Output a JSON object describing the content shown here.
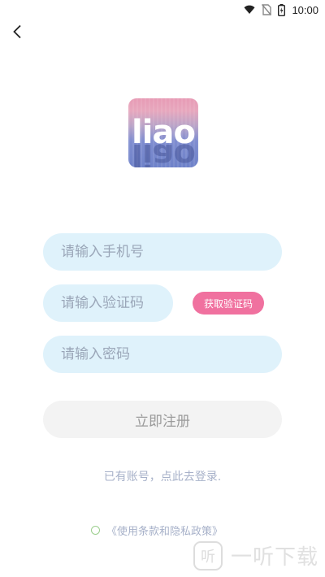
{
  "status_bar": {
    "time": "10:00",
    "icons": [
      "wifi-icon",
      "no-sim-icon",
      "battery-icon"
    ]
  },
  "header": {
    "back_icon": "chevron-left-icon"
  },
  "logo": {
    "text": "liao",
    "colors": [
      "#e79bb5",
      "#6e82c9"
    ]
  },
  "form": {
    "phone_placeholder": "请输入手机号",
    "code_placeholder": "请输入验证码",
    "get_code_label": "获取验证码",
    "password_placeholder": "请输入密码",
    "register_label": "立即注册"
  },
  "login_link": "已有账号，点此去登录.",
  "terms": {
    "label": "《使用条款和隐私政策》",
    "checked": false
  },
  "watermark": {
    "icon_char": "听",
    "text": "一听下载"
  },
  "colors": {
    "input_bg": "#dff2fb",
    "accent": "#f0719f",
    "muted_text": "#a7b1c9"
  }
}
